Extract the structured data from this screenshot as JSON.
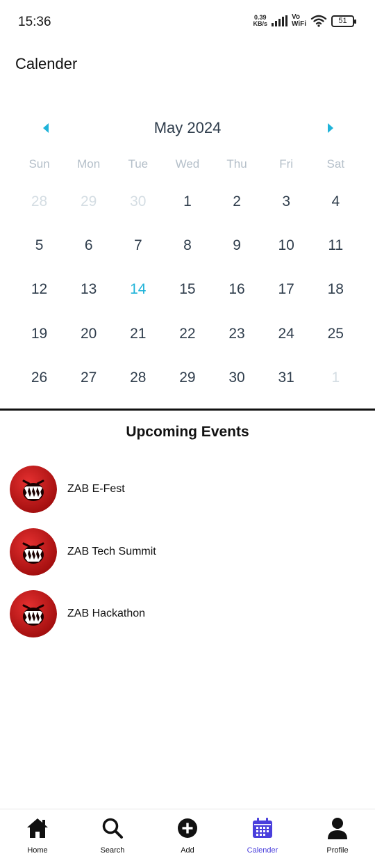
{
  "status_bar": {
    "time": "15:36",
    "net_speed_value": "0.39",
    "net_speed_unit": "KB/s",
    "vo_label": "Vo",
    "wifi_label": "WiFi",
    "battery": "51"
  },
  "header": {
    "title": "Calender"
  },
  "calendar": {
    "month_label": "May 2024",
    "weekdays": [
      "Sun",
      "Mon",
      "Tue",
      "Wed",
      "Thu",
      "Fri",
      "Sat"
    ],
    "days": [
      {
        "label": "28",
        "state": "muted"
      },
      {
        "label": "29",
        "state": "muted"
      },
      {
        "label": "30",
        "state": "muted"
      },
      {
        "label": "1",
        "state": "normal"
      },
      {
        "label": "2",
        "state": "normal"
      },
      {
        "label": "3",
        "state": "normal"
      },
      {
        "label": "4",
        "state": "normal"
      },
      {
        "label": "5",
        "state": "normal"
      },
      {
        "label": "6",
        "state": "normal"
      },
      {
        "label": "7",
        "state": "normal"
      },
      {
        "label": "8",
        "state": "normal"
      },
      {
        "label": "9",
        "state": "normal"
      },
      {
        "label": "10",
        "state": "normal"
      },
      {
        "label": "11",
        "state": "normal"
      },
      {
        "label": "12",
        "state": "normal"
      },
      {
        "label": "13",
        "state": "normal"
      },
      {
        "label": "14",
        "state": "today"
      },
      {
        "label": "15",
        "state": "normal"
      },
      {
        "label": "16",
        "state": "normal"
      },
      {
        "label": "17",
        "state": "normal"
      },
      {
        "label": "18",
        "state": "normal"
      },
      {
        "label": "19",
        "state": "normal"
      },
      {
        "label": "20",
        "state": "normal"
      },
      {
        "label": "21",
        "state": "normal"
      },
      {
        "label": "22",
        "state": "normal"
      },
      {
        "label": "23",
        "state": "normal"
      },
      {
        "label": "24",
        "state": "normal"
      },
      {
        "label": "25",
        "state": "normal"
      },
      {
        "label": "26",
        "state": "normal"
      },
      {
        "label": "27",
        "state": "normal"
      },
      {
        "label": "28",
        "state": "normal"
      },
      {
        "label": "29",
        "state": "normal"
      },
      {
        "label": "30",
        "state": "normal"
      },
      {
        "label": "31",
        "state": "normal"
      },
      {
        "label": "1",
        "state": "muted"
      }
    ],
    "prev_icon": "chevron-left-icon",
    "next_icon": "chevron-right-icon"
  },
  "events": {
    "title": "Upcoming Events",
    "items": [
      {
        "name": "ZAB E-Fest",
        "avatar_icon": "monster-avatar-icon"
      },
      {
        "name": "ZAB Tech Summit",
        "avatar_icon": "monster-avatar-icon"
      },
      {
        "name": "ZAB Hackathon",
        "avatar_icon": "monster-avatar-icon"
      }
    ]
  },
  "bottom_nav": {
    "items": [
      {
        "label": "Home",
        "icon": "home-icon",
        "active": false
      },
      {
        "label": "Search",
        "icon": "search-icon",
        "active": false
      },
      {
        "label": "Add",
        "icon": "add-circle-icon",
        "active": false
      },
      {
        "label": "Calender",
        "icon": "calendar-icon",
        "active": true
      },
      {
        "label": "Profile",
        "icon": "profile-icon",
        "active": false
      }
    ]
  },
  "colors": {
    "accent_today": "#1fb3d9",
    "nav_arrows": "#1fb3d9",
    "active_nav": "#4a3fdc",
    "avatar_red": "#d11a1a"
  }
}
